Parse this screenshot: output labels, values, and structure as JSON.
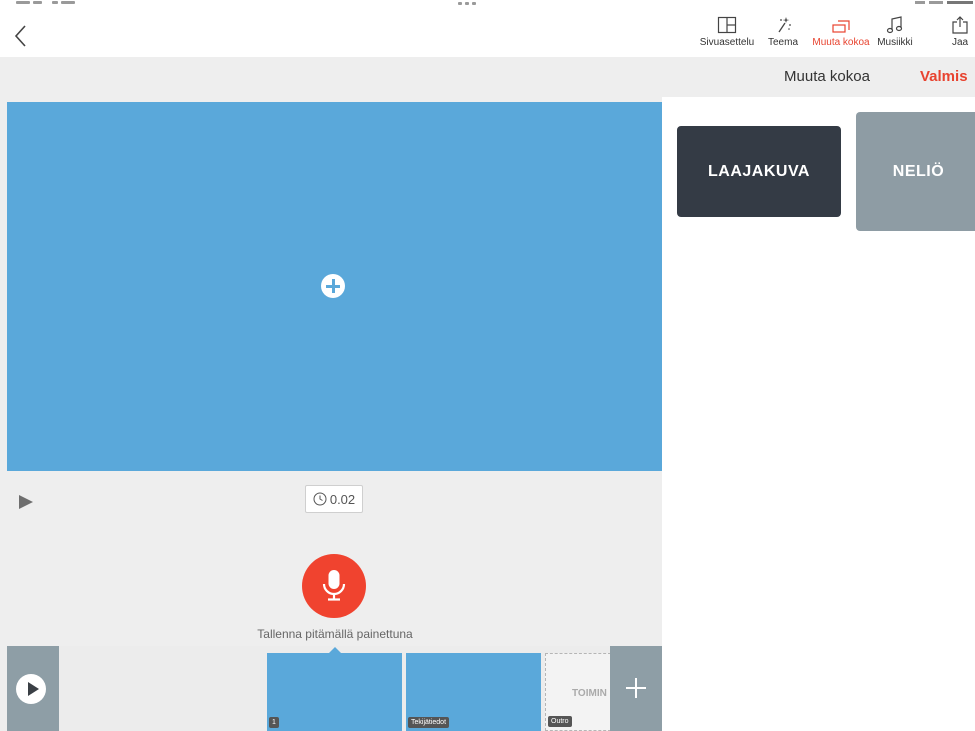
{
  "toolbar": {
    "items": [
      {
        "label": "Sivuasettelu",
        "icon": "layout-icon"
      },
      {
        "label": "Teema",
        "icon": "magic-wand-icon"
      },
      {
        "label": "Muuta kokoa",
        "icon": "resize-icon",
        "active": true
      },
      {
        "label": "Musiikki",
        "icon": "music-note-icon"
      },
      {
        "label": "Jaa",
        "icon": "share-icon"
      }
    ]
  },
  "editor": {
    "duration": "0.02",
    "record_hint": "Tallenna pitämällä painettuna"
  },
  "timeline": {
    "slides": [
      {
        "tag": "1"
      },
      {
        "tag": "Tekijätiedot"
      },
      {
        "tag": "Outro",
        "placeholder": "TOIMIN"
      }
    ]
  },
  "resize_panel": {
    "title": "Muuta kokoa",
    "done_label": "Valmis",
    "options": [
      {
        "label": "LAAJAKUVA",
        "selected": true
      },
      {
        "label": "NELIÖ",
        "selected": false
      }
    ]
  },
  "colors": {
    "accent": "#e8432f",
    "canvas": "#5aa8da",
    "record": "#f0432f",
    "option_selected": "#343b45",
    "option_unselected": "#8e9ca4"
  }
}
